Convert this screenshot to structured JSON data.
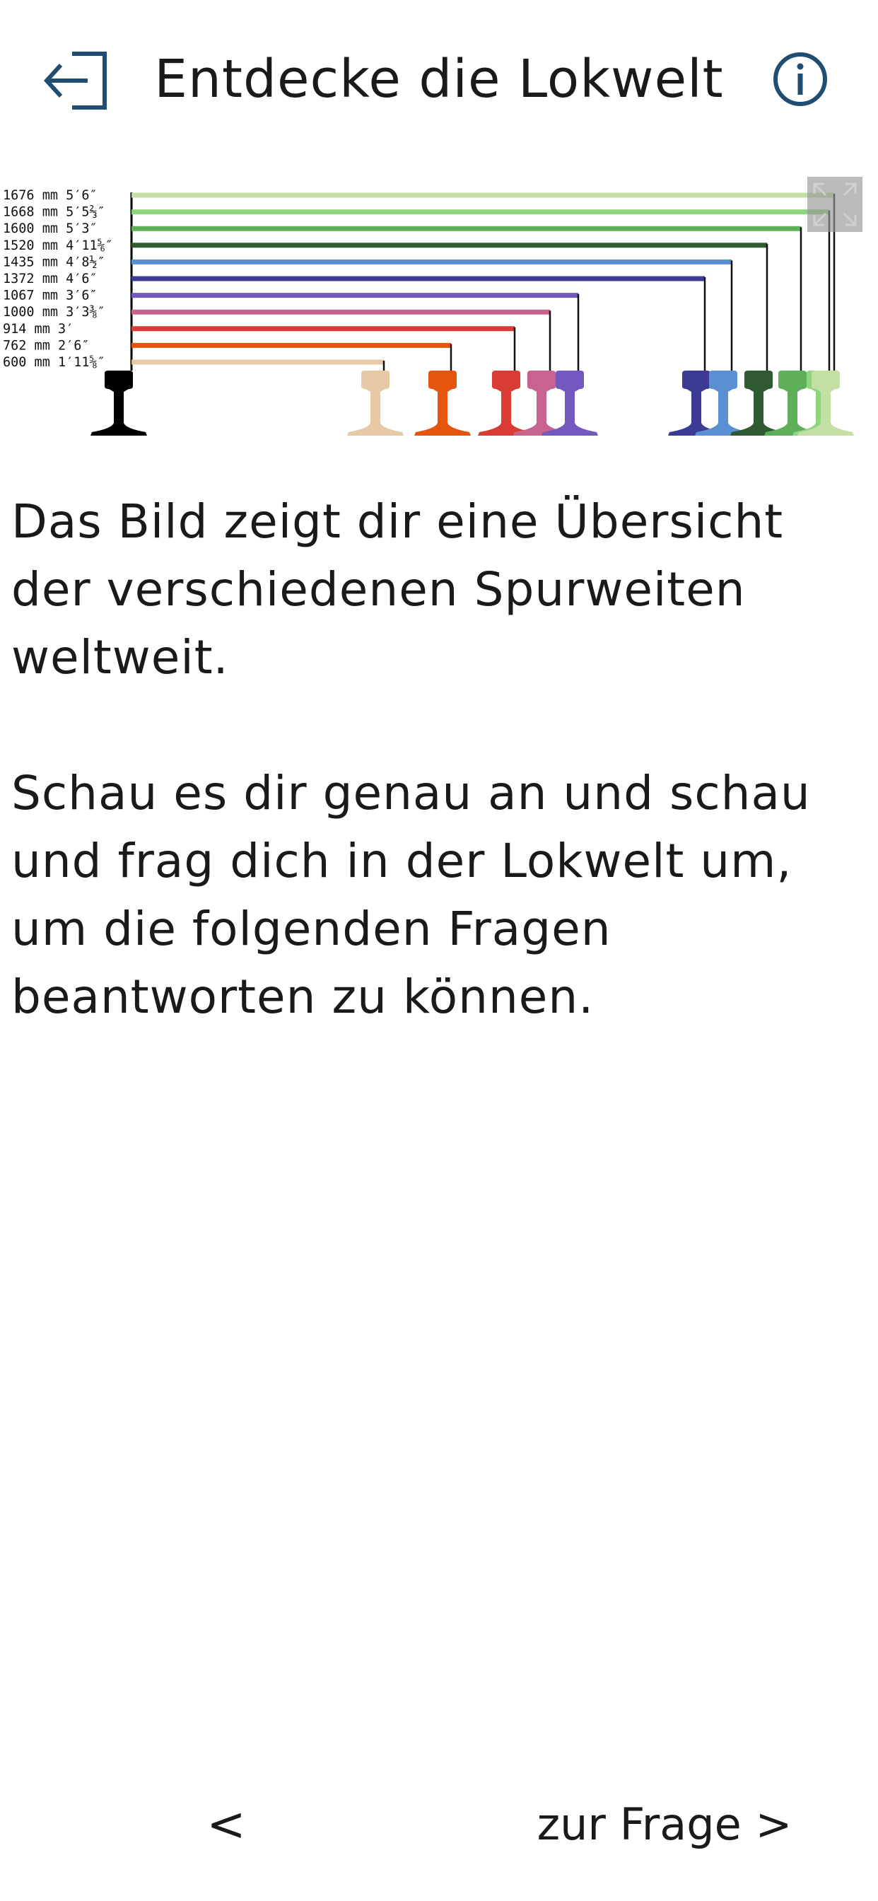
{
  "header": {
    "title": "Entdecke die Lokwelt",
    "back_icon": "exit-arrow-icon",
    "info_icon": "info-icon",
    "accent_color": "#1f4e72"
  },
  "image": {
    "expand_icon": "expand-icon",
    "gauges": [
      {
        "label": "1676 mm 5′6″",
        "color": "#c3dfa4"
      },
      {
        "label": "1668 mm 5′5⅔″",
        "color": "#8fd47e"
      },
      {
        "label": "1600 mm 5′3″",
        "color": "#5fae5a"
      },
      {
        "label": "1520 mm 4′11⅚″",
        "color": "#2f5a32"
      },
      {
        "label": "1435 mm 4′8½″",
        "color": "#5b8fd4"
      },
      {
        "label": "1372 mm 4′6″",
        "color": "#3b3a94"
      },
      {
        "label": "1067 mm 3′6″",
        "color": "#7358c0"
      },
      {
        "label": "1000 mm 3′3⅜″",
        "color": "#c8628e"
      },
      {
        "label": "914 mm 3′",
        "color": "#d83c34"
      },
      {
        "label": "762 mm 2′6″",
        "color": "#e6550d"
      },
      {
        "label": "600 mm 1′11⅝″",
        "color": "#e8c9a6"
      }
    ]
  },
  "content": {
    "intro": "Das Bild zeigt dir eine Übersicht der verschiedenen Spurweiten weltweit.",
    "instruction": "Schau es dir genau an und schau und frag dich in der Lokwelt um, um die folgenden Fragen beantworten zu können."
  },
  "navigation": {
    "prev_label": "<",
    "next_label": "zur Frage >"
  }
}
